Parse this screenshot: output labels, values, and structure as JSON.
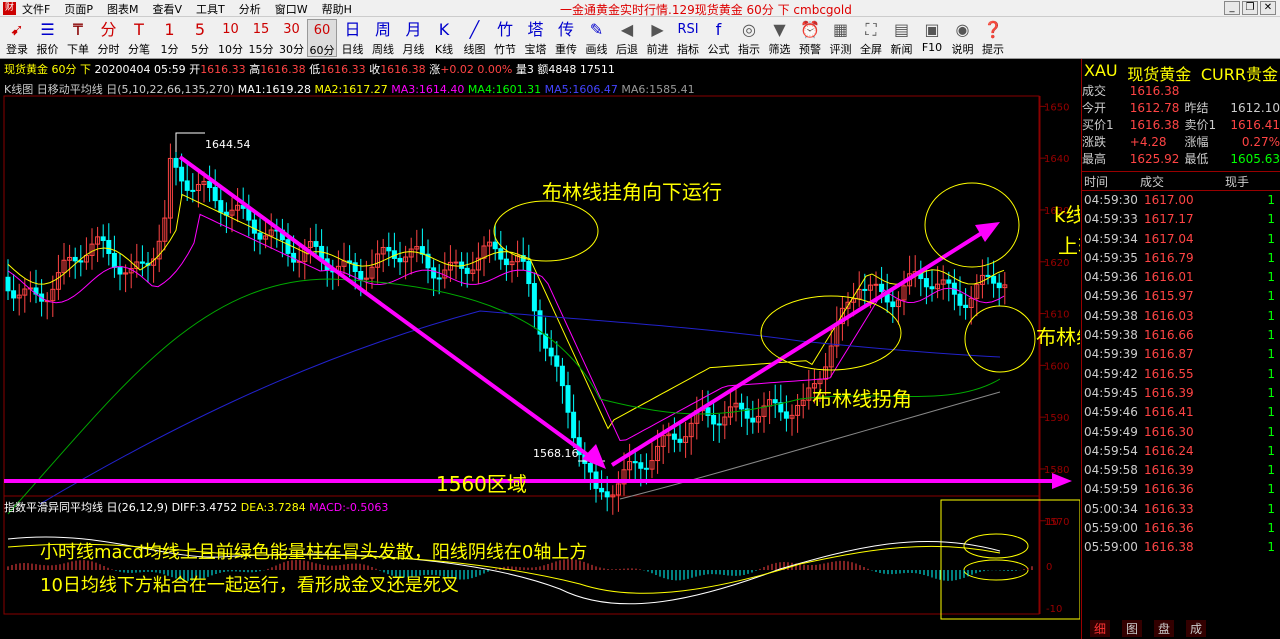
{
  "titlebar": {
    "app_icon": "财",
    "menus": [
      "文件F",
      "页面P",
      "图表M",
      "查看V",
      "工具T",
      "分析",
      "窗口W",
      "帮助H"
    ],
    "title": "一金通黄金实时行情.129现货黄金 60分 下 cmbcgold"
  },
  "toolbar": [
    {
      "g": "➹",
      "l": "登录"
    },
    {
      "g": "☰",
      "l": "报价"
    },
    {
      "g": "₸",
      "l": "下单"
    },
    {
      "g": "分",
      "l": "分时"
    },
    {
      "g": "T",
      "l": "分笔"
    },
    {
      "g": "1",
      "l": "1分"
    },
    {
      "g": "5",
      "l": "5分"
    },
    {
      "g": "10",
      "l": "10分"
    },
    {
      "g": "15",
      "l": "15分"
    },
    {
      "g": "30",
      "l": "30分"
    },
    {
      "g": "60",
      "l": "60分"
    },
    {
      "g": "日",
      "l": "日线"
    },
    {
      "g": "周",
      "l": "周线"
    },
    {
      "g": "月",
      "l": "月线"
    },
    {
      "g": "K",
      "l": "K线"
    },
    {
      "g": "╱",
      "l": "线图"
    },
    {
      "g": "竹",
      "l": "竹节"
    },
    {
      "g": "塔",
      "l": "宝塔"
    },
    {
      "g": "传",
      "l": "重传"
    },
    {
      "g": "✎",
      "l": "画线"
    },
    {
      "g": "◀",
      "l": "后退"
    },
    {
      "g": "▶",
      "l": "前进"
    },
    {
      "g": "RSI",
      "l": "指标"
    },
    {
      "g": "f",
      "l": "公式"
    },
    {
      "g": "◎",
      "l": "指示"
    },
    {
      "g": "▼",
      "l": "筛选"
    },
    {
      "g": "⏰",
      "l": "预警"
    },
    {
      "g": "▦",
      "l": "评测"
    },
    {
      "g": "⛶",
      "l": "全屏"
    },
    {
      "g": "▤",
      "l": "新闻"
    },
    {
      "g": "▣",
      "l": "F10"
    },
    {
      "g": "◉",
      "l": "说明"
    },
    {
      "g": "❓",
      "l": "提示"
    }
  ],
  "infobar": {
    "name": "现货黄金 60分 下",
    "date": "20200404 05:59",
    "open_l": "开",
    "open": "1616.33",
    "high_l": "高",
    "high": "1616.38",
    "low_l": "低",
    "low": "1616.33",
    "close_l": "收",
    "close": "1616.38",
    "chg_l": "涨",
    "chg": "+0.02",
    "pct": "0.00%",
    "vol": "量3",
    "amt": "额4848",
    "oi": "17511"
  },
  "mabar": {
    "label": "K线图 日移动平均线 日(5,10,22,66,135,270)",
    "ma1": "MA1:1619.28",
    "ma2": "MA2:1617.27",
    "ma3": "MA3:1614.40",
    "ma4": "MA4:1601.31",
    "ma5": "MA5:1606.47",
    "ma6": "MA6:1585.41"
  },
  "macdbar": {
    "label": "指数平滑异同平均线 日(26,12,9)",
    "diff": "DIFF:3.4752",
    "dea": "DEA:3.7284",
    "macd": "MACD:-0.5063"
  },
  "chart_data": {
    "type": "candlestick",
    "yticks": [
      1650,
      1640,
      1630,
      1620,
      1610,
      1600,
      1590,
      1580,
      1570
    ],
    "xticks": [
      "3",
      "26",
      "12:00",
      "27",
      "09:00",
      "20:00",
      "28",
      "30",
      "31",
      "09:00",
      "20:00",
      "4",
      "16:00",
      "2",
      "10:00",
      "21:00",
      "3",
      "15:00",
      "4"
    ],
    "high_label": "1644.54",
    "low_label": "1568.16",
    "macd_ticks": [
      "10",
      "0",
      "-10"
    ]
  },
  "annotations": {
    "a1": "布林线挂角向下运行",
    "a2": "k线整体在布林线",
    "a2b": "上轨运行",
    "a3": "布林线向上发散运行",
    "a4": "布林线拐角",
    "a5": "1560区域",
    "a6": "小时线macd均线上且前绿色能量柱在冒头发散，阳线阴线在0轴上方",
    "a7": "10日均线下方粘合在一起运行，看形成金叉还是死叉"
  },
  "quote": {
    "code": "XAU",
    "name": "现货黄金",
    "type": "CURR贵金",
    "rows": [
      [
        "成交",
        "1616.38",
        "",
        ""
      ],
      [
        "今开",
        "1612.78",
        "昨结",
        "1612.10"
      ],
      [
        "买价1",
        "1616.38",
        "卖价1",
        "1616.41"
      ],
      [
        "涨跌",
        "+4.28",
        "涨幅",
        "0.27%"
      ],
      [
        "最高",
        "1625.92",
        "最低",
        "1605.63"
      ]
    ]
  },
  "ticks_head": [
    "时间",
    "成交",
    "现手"
  ],
  "ticks": [
    [
      "04:59:30",
      "1617.00",
      "1"
    ],
    [
      "04:59:33",
      "1617.17",
      "1"
    ],
    [
      "04:59:34",
      "1617.04",
      "1"
    ],
    [
      "04:59:35",
      "1616.79",
      "1"
    ],
    [
      "04:59:36",
      "1616.01",
      "1"
    ],
    [
      "04:59:36",
      "1615.97",
      "1"
    ],
    [
      "04:59:38",
      "1616.03",
      "1"
    ],
    [
      "04:59:38",
      "1616.66",
      "1"
    ],
    [
      "04:59:39",
      "1616.87",
      "1"
    ],
    [
      "04:59:42",
      "1616.55",
      "1"
    ],
    [
      "04:59:45",
      "1616.39",
      "1"
    ],
    [
      "04:59:46",
      "1616.41",
      "1"
    ],
    [
      "04:59:49",
      "1616.30",
      "1"
    ],
    [
      "04:59:54",
      "1616.24",
      "1"
    ],
    [
      "04:59:58",
      "1616.39",
      "1"
    ],
    [
      "04:59:59",
      "1616.36",
      "1"
    ],
    [
      "05:00:34",
      "1616.33",
      "1"
    ],
    [
      "05:59:00",
      "1616.36",
      "1"
    ],
    [
      "05:59:00",
      "1616.38",
      "1"
    ]
  ],
  "bottomtabs": [
    "细",
    "图",
    "盘",
    "成"
  ]
}
